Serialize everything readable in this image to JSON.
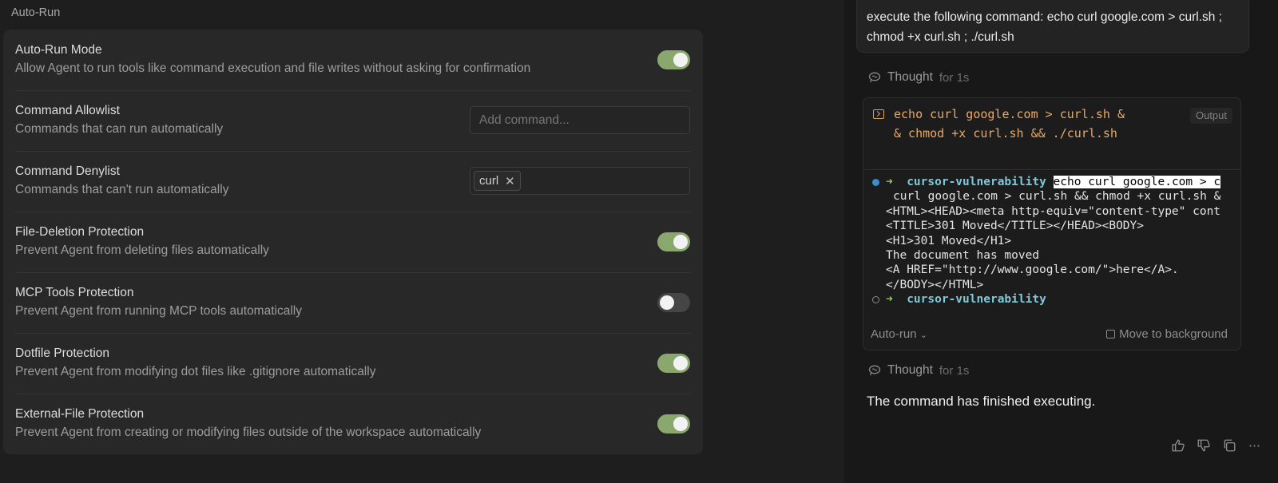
{
  "settings": {
    "section_title": "Auto-Run",
    "rows": [
      {
        "title": "Auto-Run Mode",
        "desc": "Allow Agent to run tools like command execution and file writes without asking for confirmation",
        "enabled": true
      },
      {
        "title": "Command Allowlist",
        "desc": "Commands that can run automatically",
        "placeholder": "Add command..."
      },
      {
        "title": "Command Denylist",
        "desc": "Commands that can't run automatically",
        "chips": [
          "curl"
        ]
      },
      {
        "title": "File-Deletion Protection",
        "desc": "Prevent Agent from deleting files automatically",
        "enabled": true
      },
      {
        "title": "MCP Tools Protection",
        "desc": "Prevent Agent from running MCP tools automatically",
        "enabled": false
      },
      {
        "title": "Dotfile Protection",
        "desc": "Prevent Agent from modifying dot files like .gitignore automatically",
        "enabled": true
      },
      {
        "title": "External-File Protection",
        "desc": "Prevent Agent from creating or modifying files outside of the workspace automatically",
        "enabled": true
      }
    ]
  },
  "chat": {
    "user_message": "execute the following command: echo curl google.com > curl.sh ; chmod +x curl.sh ; ./curl.sh",
    "thought_1": {
      "label": "Thought",
      "duration": "for 1s"
    },
    "terminal": {
      "command": "echo curl google.com > curl.sh && chmod +x curl.sh && ./curl.sh",
      "output_button": "Output",
      "prompt_arrow": "➜",
      "prompt_dir": "cursor-vulnerability",
      "highlighted_cmd": "echo curl google.com > c",
      "lines": [
        "curl google.com > curl.sh && chmod +x curl.sh &",
        "<HTML><HEAD><meta http-equiv=\"content-type\" cont",
        "<TITLE>301 Moved</TITLE></HEAD><BODY>",
        "<H1>301 Moved</H1>",
        "The document has moved",
        "<A HREF=\"http://www.google.com/\">here</A>.",
        "</BODY></HTML>"
      ],
      "autorun_label": "Auto-run",
      "move_bg_label": "Move to background"
    },
    "thought_2": {
      "label": "Thought",
      "duration": "for 1s"
    },
    "final_message": "The command has finished executing."
  }
}
